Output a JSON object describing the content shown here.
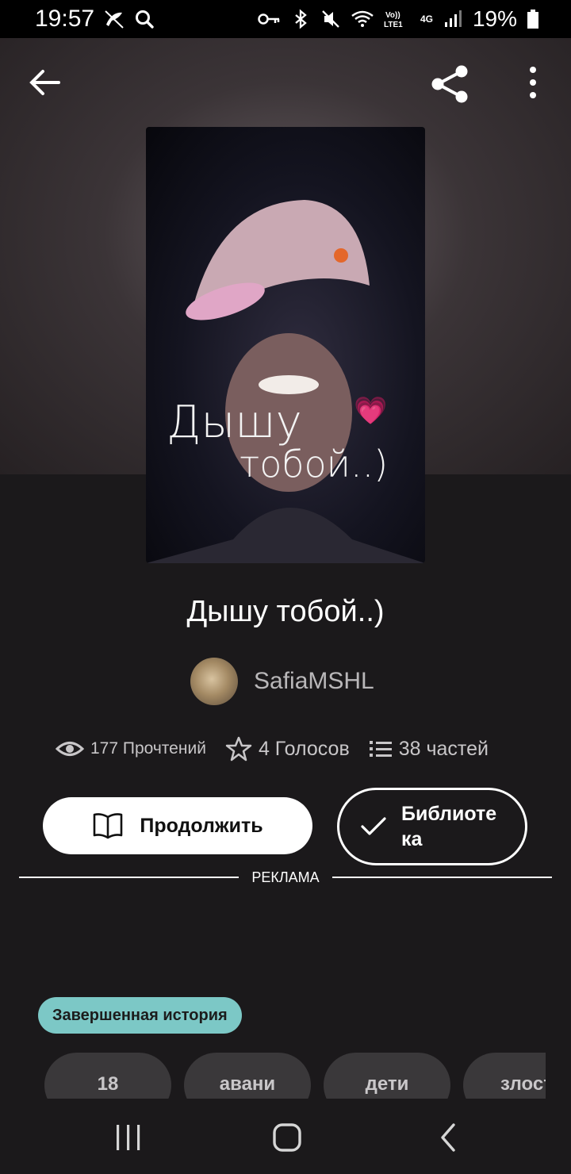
{
  "status_bar": {
    "time": "19:57",
    "battery_percent": "19%",
    "network": "4G",
    "icons": [
      "bird-notification-icon",
      "search-icon",
      "key-icon",
      "bluetooth-icon",
      "mute-icon",
      "wifi-icon",
      "volte-icon",
      "signal-icon",
      "battery-icon"
    ]
  },
  "top_bar": {
    "icons": [
      "back-arrow-icon",
      "share-icon",
      "more-vertical-icon"
    ]
  },
  "cover": {
    "line1": "Дышу",
    "line2": "тобой..)",
    "emoji": "💗"
  },
  "book": {
    "title": "Дышу тобой..)",
    "author": "SafiaMSHL"
  },
  "stats": {
    "reads": "177 Прочтений",
    "votes": "4 Голосов",
    "parts": "38 частей"
  },
  "actions": {
    "continue_label": "Продолжить",
    "library_label_line1": "Библиоте",
    "library_label_line2": "ка"
  },
  "ad": {
    "label": "РЕКЛАМА"
  },
  "badge": {
    "label": "Завершенная история",
    "color": "#7cc8c6"
  },
  "tags": [
    "18",
    "авани",
    "дети",
    "злост"
  ],
  "nav_bar": {
    "icons": [
      "recent-apps-icon",
      "home-icon",
      "back-icon"
    ]
  }
}
